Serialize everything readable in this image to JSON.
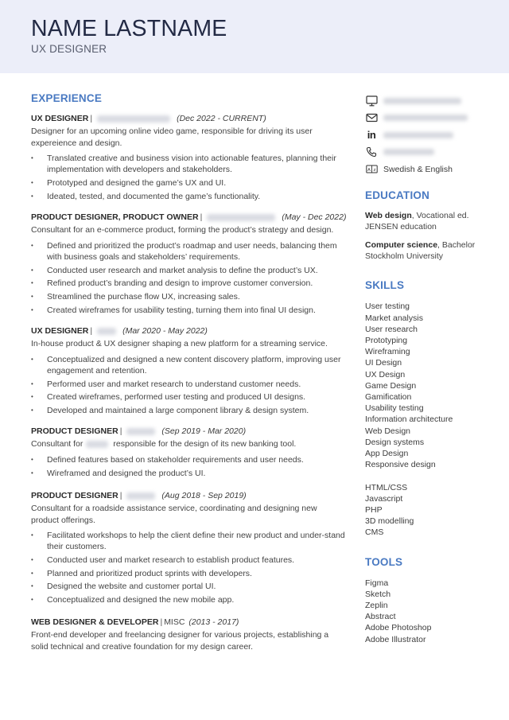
{
  "header": {
    "name": "NAME LASTNAME",
    "role": "UX DESIGNER"
  },
  "colors": {
    "header_bg": "#eceef9",
    "accent": "#4a7ac2",
    "name": "#232a45"
  },
  "experience": {
    "title": "EXPERIENCE",
    "jobs": [
      {
        "title": "UX DESIGNER",
        "company_redacted": true,
        "dates": "(Dec 2022 - CURRENT)",
        "description": "Designer for an upcoming online video game, responsible for driving its user expereience and design.",
        "bullets": [
          "Translated creative and business vision into actionable features, planning their implementation with developers and stakeholders.",
          "Prototyped and designed the game’s UX and UI.",
          "Ideated, tested, and documented the game’s functionality."
        ]
      },
      {
        "title": "PRODUCT DESIGNER, PRODUCT OWNER",
        "company_redacted": true,
        "dates": "(May - Dec 2022)",
        "description": "Consultant for an e-commerce product, forming the product’s strategy and design.",
        "bullets": [
          "Defined and prioritized the product’s roadmap and user needs, balancing them with business goals and stakeholders’ requirements.",
          "Conducted user research and market analysis to define the product’s UX.",
          "Refined product’s branding and design to improve customer conversion.",
          "Streamlined the purchase flow UX, increasing sales.",
          "Created wireframes for usability testing, turning them into final UI design."
        ]
      },
      {
        "title": "UX DESIGNER",
        "company_redacted": true,
        "dates": "(Mar 2020 - May 2022)",
        "description": "In-house product & UX designer shaping a new platform for a streaming service.",
        "bullets": [
          "Conceptualized and designed a new content discovery platform, improving user engagement and retention.",
          "Performed user and market research to understand customer needs.",
          "Created wireframes, performed user testing and produced UI designs.",
          "Developed and maintained a large component library & design system."
        ]
      },
      {
        "title": "PRODUCT DESIGNER",
        "company_redacted": true,
        "dates": "(Sep 2019 - Mar 2020)",
        "description_prefix": "Consultant for",
        "description_suffix": "responsible for the design of its new banking tool.",
        "bullets": [
          "Defined features based on stakeholder requirements and user needs.",
          "Wireframed and designed the product’s UI."
        ]
      },
      {
        "title": "PRODUCT DESIGNER",
        "company_redacted": true,
        "dates": "(Aug 2018 - Sep 2019)",
        "description": "Consultant for a roadside assistance service, coordinating and designing new product offerings.",
        "bullets": [
          "Facilitated workshops to help the client define their new product and under-stand their customers.",
          "Conducted user and market research to establish product features.",
          "Planned and prioritized product sprints with developers.",
          "Designed the website and customer portal UI.",
          "Conceptualized and designed the new mobile app."
        ]
      },
      {
        "title": "WEB DESIGNER & DEVELOPER",
        "company": "MISC",
        "dates": "(2013 - 2017)",
        "description": "Front-end developer and freelancing designer for various projects, establishing a solid technical and creative foundation for my design career."
      }
    ]
  },
  "contact": {
    "items": [
      {
        "icon": "monitor-icon",
        "value_redacted": true
      },
      {
        "icon": "mail-icon",
        "value_redacted": true
      },
      {
        "icon": "linkedin-icon",
        "icon_text": "in",
        "value_redacted": true
      },
      {
        "icon": "phone-icon",
        "value_redacted": true
      },
      {
        "icon": "language-icon",
        "value": "Swedish & English"
      }
    ]
  },
  "education": {
    "title": "EDUCATION",
    "items": [
      {
        "field": "Web design",
        "degree": ", Vocational ed.",
        "school": "JENSEN education"
      },
      {
        "field": "Computer science",
        "degree": ", Bachelor",
        "school": "Stockholm University"
      }
    ]
  },
  "skills": {
    "title": "SKILLS",
    "primary": [
      "User testing",
      "Market analysis",
      "User research",
      "Prototyping",
      "Wireframing",
      "UI Design",
      "UX Design",
      "Game Design",
      "Gamification",
      "Usability testing",
      "Information architecture",
      "Web Design",
      "Design systems",
      "App Design",
      "Responsive design"
    ],
    "technical": [
      "HTML/CSS",
      "Javascript",
      "PHP",
      "3D modelling",
      "CMS"
    ]
  },
  "tools": {
    "title": "TOOLS",
    "items": [
      "Figma",
      "Sketch",
      "Zeplin",
      "Abstract",
      "Adobe Photoshop",
      "Adobe Illustrator"
    ]
  }
}
